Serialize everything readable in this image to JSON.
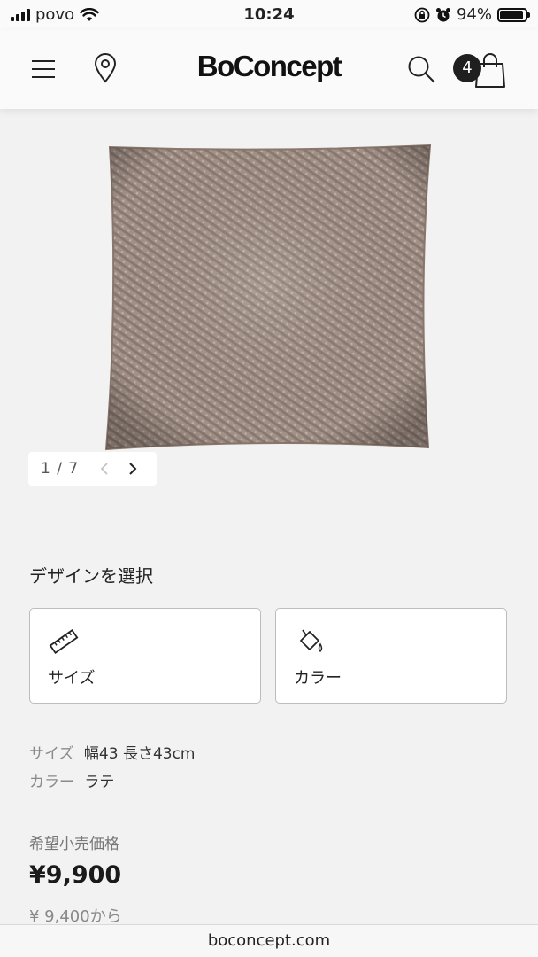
{
  "status_bar": {
    "carrier": "povo",
    "time": "10:24",
    "battery": "94%",
    "battery_level": 0.94
  },
  "header": {
    "logo": "BoConcept",
    "cart_count": "4"
  },
  "gallery": {
    "counter": "1 / 7",
    "prev": "‹",
    "next": "›"
  },
  "design": {
    "title": "デザインを選択",
    "options": [
      {
        "label": "サイズ",
        "icon": "ruler-icon"
      },
      {
        "label": "カラー",
        "icon": "paint-bucket-icon"
      }
    ]
  },
  "specs": [
    {
      "key": "サイズ",
      "value": "幅43 長さ43cm"
    },
    {
      "key": "カラー",
      "value": "ラテ"
    }
  ],
  "pricing": {
    "label": "希望小売価格",
    "price": "¥9,900",
    "from": "¥ 9,400から"
  },
  "browser": {
    "url": "boconcept.com"
  },
  "colors": {
    "background": "#f2f2f2",
    "badge": "#1f1f1f",
    "card_border": "#bdbdbd",
    "cushion": "#a08f84"
  }
}
